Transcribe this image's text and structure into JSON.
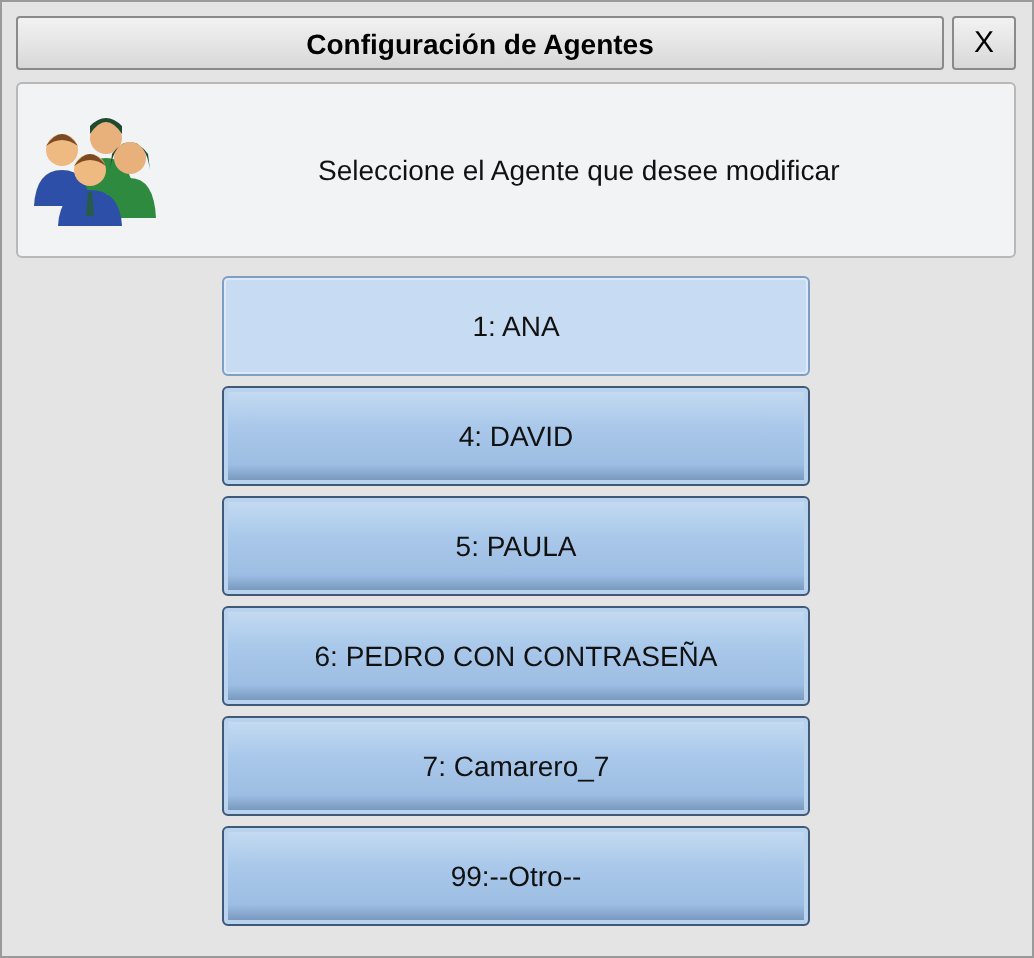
{
  "window": {
    "title": "Configuración de Agentes",
    "close_label": "X"
  },
  "header": {
    "message": "Seleccione el Agente que desee modificar"
  },
  "agents": [
    {
      "label": "1: ANA",
      "selected": true
    },
    {
      "label": "4: DAVID",
      "selected": false
    },
    {
      "label": "5: PAULA",
      "selected": false
    },
    {
      "label": "6: PEDRO CON CONTRASEÑA",
      "selected": false
    },
    {
      "label": "7: Camarero_7",
      "selected": false
    },
    {
      "label": "99:--Otro--",
      "selected": false
    }
  ]
}
